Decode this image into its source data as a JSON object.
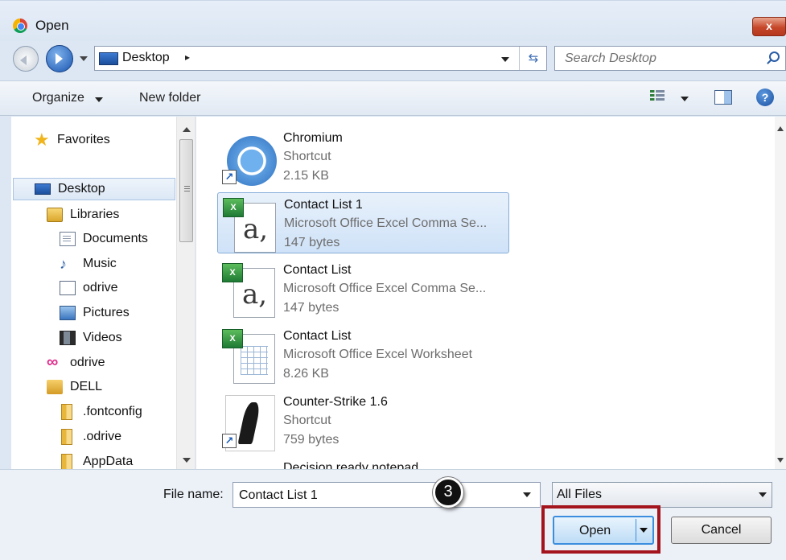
{
  "window": {
    "title": "Open",
    "close_label": "x"
  },
  "address": {
    "location": "Desktop",
    "separator": "▸",
    "search_placeholder": "Search Desktop"
  },
  "toolbar": {
    "organize_label": "Organize",
    "new_folder_label": "New folder",
    "help_label": "?"
  },
  "nav": {
    "items": [
      {
        "label": "Favorites",
        "icon": "star-icon"
      },
      {
        "label": "Desktop",
        "icon": "desktop-icon",
        "selected": true
      },
      {
        "label": "Libraries",
        "icon": "libraries-icon"
      },
      {
        "label": "Documents",
        "icon": "documents-icon"
      },
      {
        "label": "Music",
        "icon": "music-icon"
      },
      {
        "label": "odrive",
        "icon": "odrive-library-icon"
      },
      {
        "label": "Pictures",
        "icon": "pictures-icon"
      },
      {
        "label": "Videos",
        "icon": "videos-icon"
      },
      {
        "label": "odrive",
        "icon": "odrive-infinity-icon"
      },
      {
        "label": "DELL",
        "icon": "user-folder-icon"
      },
      {
        "label": ".fontconfig",
        "icon": "folder-icon"
      },
      {
        "label": ".odrive",
        "icon": "folder-icon"
      },
      {
        "label": "AppData",
        "icon": "folder-icon"
      }
    ]
  },
  "files": [
    {
      "name": "Chromium",
      "type": "Shortcut",
      "size": "2.15 KB",
      "icon": "chromium-icon",
      "selected": false
    },
    {
      "name": "Contact List 1",
      "type": "Microsoft Office Excel Comma Se...",
      "size": "147 bytes",
      "icon": "csv-file-icon",
      "selected": true
    },
    {
      "name": "Contact List",
      "type": "Microsoft Office Excel Comma Se...",
      "size": "147 bytes",
      "icon": "csv-file-icon",
      "selected": false
    },
    {
      "name": "Contact List",
      "type": "Microsoft Office Excel Worksheet",
      "size": "8.26 KB",
      "icon": "excel-worksheet-icon",
      "selected": false
    },
    {
      "name": "Counter-Strike 1.6",
      "type": "Shortcut",
      "size": "759 bytes",
      "icon": "counter-strike-icon",
      "selected": false
    },
    {
      "name": "Decision ready notepad",
      "type": "",
      "size": "",
      "icon": "text-file-icon",
      "selected": false
    }
  ],
  "footer": {
    "file_name_label": "File name:",
    "file_name_value": "Contact List 1",
    "step_badge": "3",
    "file_type_value": "All Files",
    "open_label": "Open",
    "cancel_label": "Cancel"
  },
  "colors": {
    "highlight_box": "#a3141c",
    "selection": "#cfe2f8",
    "accent": "#3b8ede"
  }
}
